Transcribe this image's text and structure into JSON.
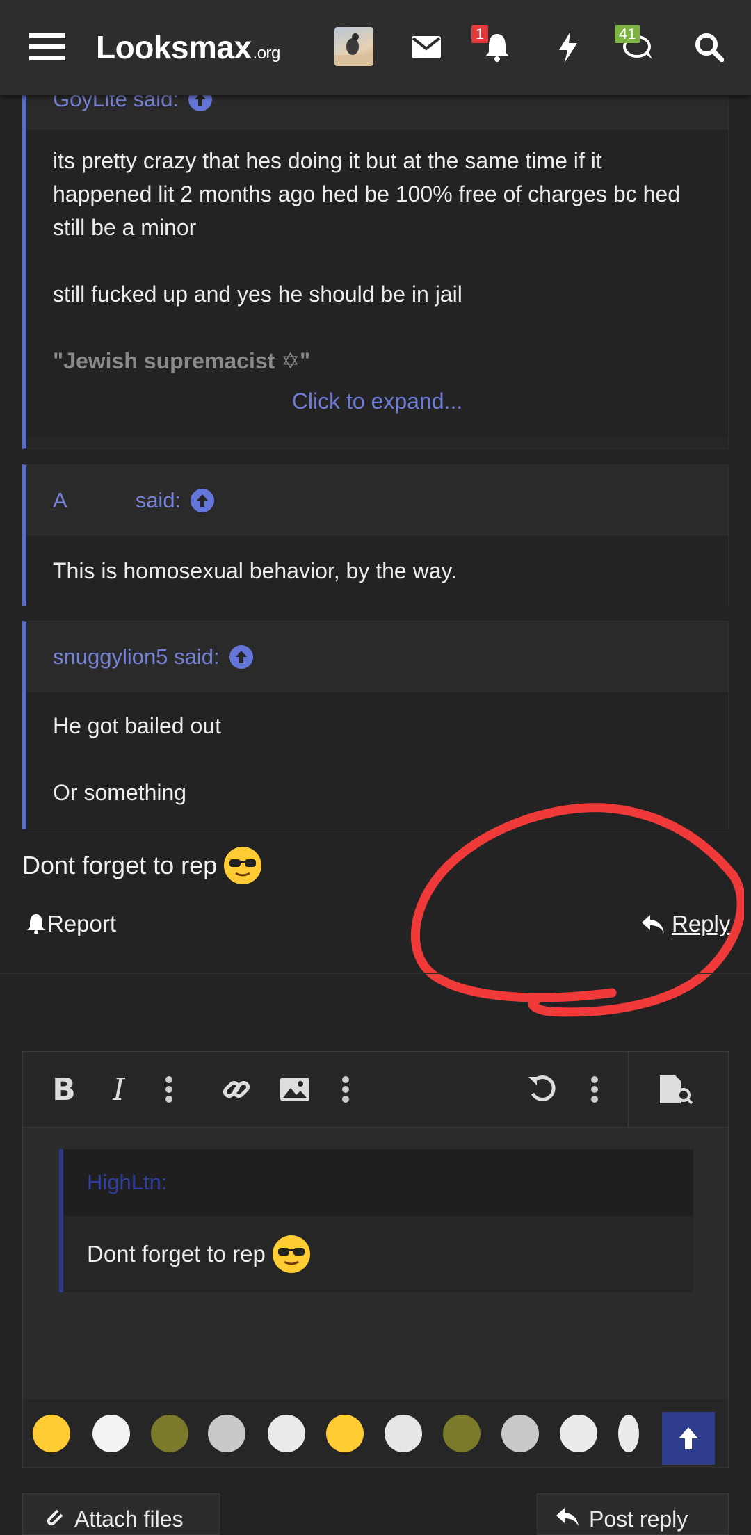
{
  "header": {
    "logo_text": "Looksmax",
    "logo_suffix": ".org",
    "notifications_count": "1",
    "conversations_count": "41"
  },
  "quotes": [
    {
      "author_label": "GoyLite said:",
      "paragraphs": [
        "its pretty crazy that hes doing it but at the same time if it happened lit 2 months ago hed be 100% free of charges bc hed still be a minor",
        "still fucked up and yes he should be in jail"
      ],
      "signature": "\"Jewish supremacist ✡\"",
      "expand_label": "Click to expand..."
    },
    {
      "author_initial": "A",
      "said_label": "said:",
      "paragraphs": [
        "This is homosexual behavior, by the way."
      ]
    },
    {
      "author_label": "snuggylion5 said:",
      "paragraphs": [
        "He got bailed out",
        "Or something"
      ]
    }
  ],
  "post": {
    "text": "Dont forget to rep",
    "report_label": "Report",
    "reply_label": "Reply"
  },
  "editor": {
    "quote_author": "HighLtn:",
    "quote_text": "Dont forget to rep"
  },
  "footer": {
    "attach_label": "Attach files",
    "post_reply_label": "Post reply"
  },
  "colors": {
    "accent": "#5b6cc9",
    "annotation": "#f03a3a",
    "background": "#232323"
  }
}
